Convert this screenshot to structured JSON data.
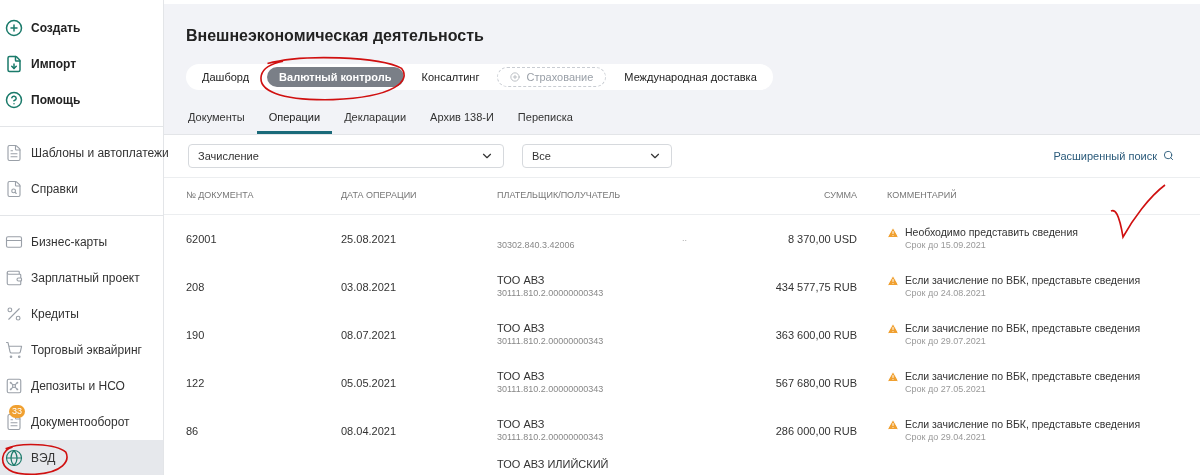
{
  "sidebar": {
    "groups": [
      [
        {
          "label": "Создать",
          "kind": "action",
          "selected": false
        },
        {
          "label": "Импорт",
          "kind": "action",
          "selected": false
        },
        {
          "label": "Помощь",
          "kind": "action",
          "selected": false
        }
      ],
      [
        {
          "label": "Шаблоны и автоплатежи",
          "kind": "nav",
          "selected": false
        },
        {
          "label": "Справки",
          "kind": "nav",
          "selected": false
        }
      ],
      [
        {
          "label": "Бизнес-карты",
          "kind": "nav",
          "selected": false
        },
        {
          "label": "Зарплатный проект",
          "kind": "nav",
          "selected": false
        },
        {
          "label": "Кредиты",
          "kind": "nav",
          "selected": false
        },
        {
          "label": "Торговый эквайринг",
          "kind": "nav",
          "selected": false
        },
        {
          "label": "Депозиты и НСО",
          "kind": "nav",
          "selected": false
        },
        {
          "label": "Документооборот",
          "kind": "nav",
          "badge": "33",
          "selected": false
        },
        {
          "label": "ВЭД",
          "kind": "nav",
          "selected": true
        }
      ]
    ]
  },
  "page": {
    "title": "Внешнеэкономическая деятельность",
    "section_tabs": [
      {
        "label": "Дашборд",
        "selected": false,
        "disabled": false
      },
      {
        "label": "Валютный контроль",
        "selected": true,
        "disabled": false
      },
      {
        "label": "Консалтинг",
        "selected": false,
        "disabled": false
      },
      {
        "label": "Страхование",
        "selected": false,
        "disabled": true
      },
      {
        "label": "Международная доставка",
        "selected": false,
        "disabled": false
      }
    ],
    "sub_tabs": [
      {
        "label": "Документы",
        "selected": false
      },
      {
        "label": "Операции",
        "selected": true
      },
      {
        "label": "Декларации",
        "selected": false
      },
      {
        "label": "Архив 138-И",
        "selected": false
      },
      {
        "label": "Переписка",
        "selected": false
      }
    ]
  },
  "filters": {
    "operation_type": "Зачисление",
    "status": "Все",
    "advanced_search": "Расширенный поиск"
  },
  "table": {
    "columns": [
      "№ ДОКУМЕНТА",
      "ДАТА ОПЕРАЦИИ",
      "ПЛАТЕЛЬЩИК/ПОЛУЧАТЕЛЬ",
      "СУММА",
      "КОММЕНТАРИЙ"
    ],
    "rows": [
      {
        "number": "62001",
        "date": "25.08.2021",
        "account": "30302.840.3.42006",
        "more": "..",
        "amount": "8 370,00 USD",
        "comment": "Необходимо представить сведения",
        "deadline": "Срок до 15.09.2021"
      },
      {
        "number": "208",
        "date": "03.08.2021",
        "payer": "ТОО АВЗ",
        "account": "30111.810.2.00000000343",
        "amount": "434 577,75 RUB",
        "comment": "Если зачисление по ВБК, представьте сведения",
        "deadline": "Срок до 24.08.2021"
      },
      {
        "number": "190",
        "date": "08.07.2021",
        "payer": "ТОО АВЗ",
        "account": "30111.810.2.00000000343",
        "amount": "363 600,00 RUB",
        "comment": "Если зачисление по ВБК, представьте сведения",
        "deadline": "Срок до 29.07.2021"
      },
      {
        "number": "122",
        "date": "05.05.2021",
        "payer": "ТОО АВЗ",
        "account": "30111.810.2.00000000343",
        "amount": "567 680,00 RUB",
        "comment": "Если зачисление по ВБК, представьте сведения",
        "deadline": "Срок до 27.05.2021"
      },
      {
        "number": "86",
        "date": "08.04.2021",
        "payer": "ТОО АВЗ",
        "account": "30111.810.2.00000000343",
        "amount": "286 000,00 RUB",
        "comment": "Если зачисление по ВБК, представьте сведения",
        "deadline": "Срок до 29.04.2021"
      },
      {
        "payer": "ТОО АВЗ ИЛИЙСКИЙ"
      }
    ]
  }
}
